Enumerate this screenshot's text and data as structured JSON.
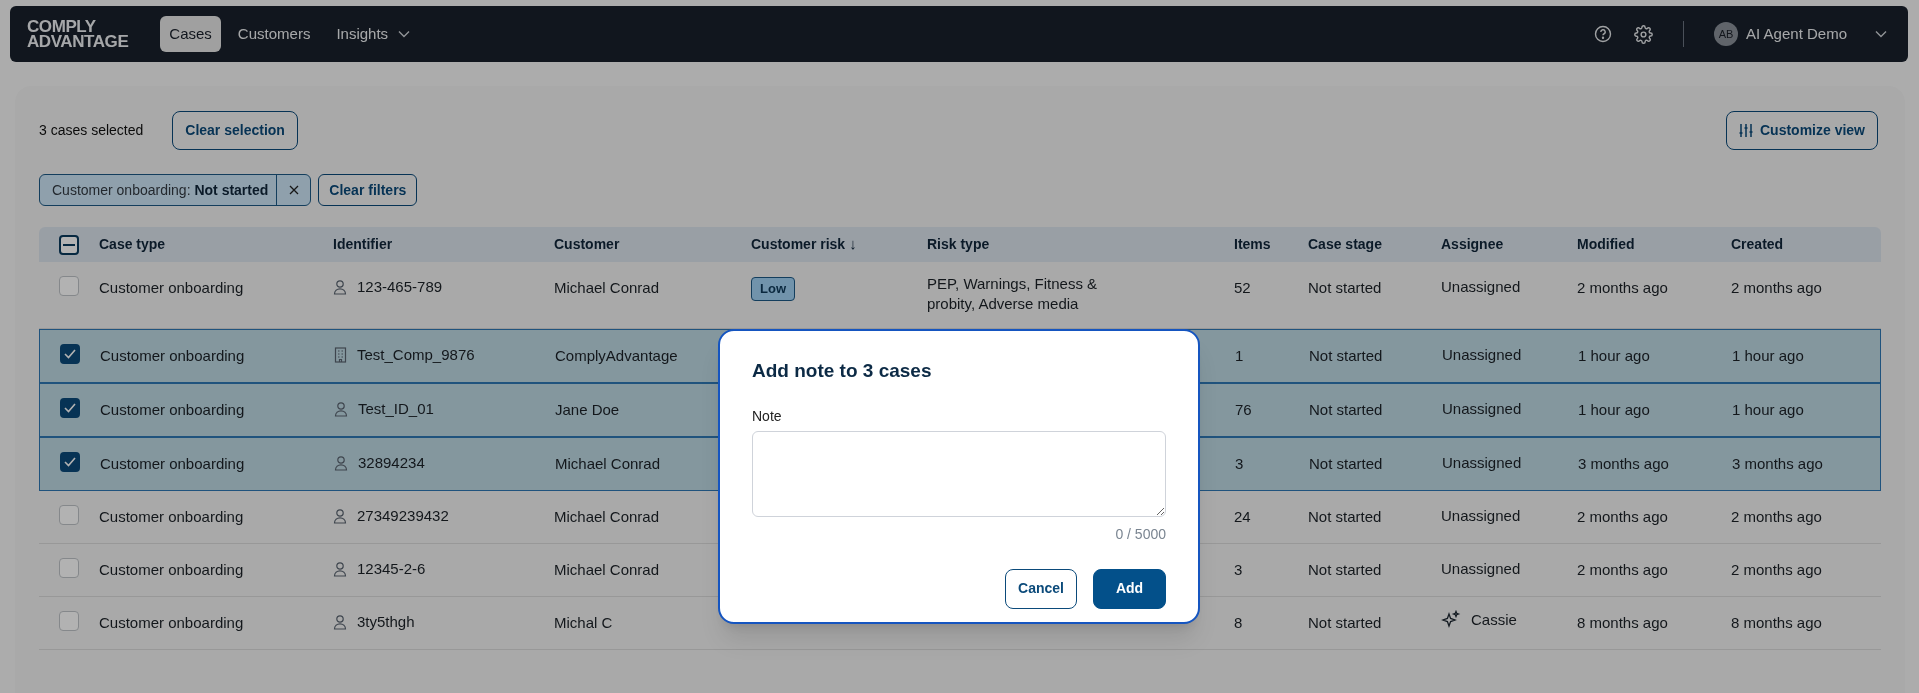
{
  "nav": {
    "logo": [
      "COMPLY",
      "ADVANTAGE"
    ],
    "items": [
      {
        "label": "Cases",
        "selected": true,
        "dropdown": false
      },
      {
        "label": "Customers",
        "selected": false,
        "dropdown": false
      },
      {
        "label": "Insights",
        "selected": false,
        "dropdown": true
      }
    ],
    "user": {
      "initials": "AB",
      "name": "AI Agent Demo"
    }
  },
  "selection": {
    "count_text": "3 cases selected",
    "clear_button": "Clear selection"
  },
  "customize_button": "Customize view",
  "filters": [
    {
      "label": "Customer onboarding:",
      "value": "Not started"
    }
  ],
  "clear_filters": "Clear filters",
  "table": {
    "select_all": {
      "indeterminate": true
    },
    "columns": [
      {
        "label": "Case type"
      },
      {
        "label": "Identifier"
      },
      {
        "label": "Customer"
      },
      {
        "label": "Customer risk",
        "sort_indicator": "↓"
      },
      {
        "label": "Risk type"
      },
      {
        "label": "Items"
      },
      {
        "label": "Case stage"
      },
      {
        "label": "Assignee"
      },
      {
        "label": "Modified"
      },
      {
        "label": "Created"
      }
    ],
    "rows": [
      {
        "selected": false,
        "case_type": "Customer onboarding",
        "identifier": {
          "kind": "person",
          "text": "123-465-789"
        },
        "customer": "Michael Conrad",
        "risk": "Low",
        "risk_type": "PEP, Warnings, Fitness & probity, Adverse media",
        "items": "52",
        "stage": "Not started",
        "assignee": {
          "kind": "none",
          "text": "Unassigned"
        },
        "modified": "2 months ago",
        "created": "2 months ago"
      },
      {
        "selected": true,
        "case_type": "Customer onboarding",
        "identifier": {
          "kind": "company",
          "text": "Test_Comp_9876"
        },
        "customer": "ComplyAdvantage",
        "items": "1",
        "stage": "Not started",
        "assignee": {
          "kind": "none",
          "text": "Unassigned"
        },
        "modified": "1 hour ago",
        "created": "1 hour ago"
      },
      {
        "selected": true,
        "case_type": "Customer onboarding",
        "identifier": {
          "kind": "person",
          "text": "Test_ID_01"
        },
        "customer": "Jane Doe",
        "items": "76",
        "stage": "Not started",
        "assignee": {
          "kind": "none",
          "text": "Unassigned"
        },
        "modified": "1 hour ago",
        "created": "1 hour ago"
      },
      {
        "selected": true,
        "case_type": "Customer onboarding",
        "identifier": {
          "kind": "person",
          "text": "32894234"
        },
        "customer": "Michael Conrad",
        "items": "3",
        "stage": "Not started",
        "assignee": {
          "kind": "none",
          "text": "Unassigned"
        },
        "modified": "3 months ago",
        "created": "3 months ago"
      },
      {
        "selected": false,
        "case_type": "Customer onboarding",
        "identifier": {
          "kind": "person",
          "text": "27349239432"
        },
        "customer": "Michael Conrad",
        "items": "24",
        "stage": "Not started",
        "assignee": {
          "kind": "none",
          "text": "Unassigned"
        },
        "modified": "2 months ago",
        "created": "2 months ago"
      },
      {
        "selected": false,
        "case_type": "Customer onboarding",
        "identifier": {
          "kind": "person",
          "text": "12345-2-6"
        },
        "customer": "Michael Conrad",
        "items": "3",
        "stage": "Not started",
        "assignee": {
          "kind": "none",
          "text": "Unassigned"
        },
        "modified": "2 months ago",
        "created": "2 months ago"
      },
      {
        "selected": false,
        "case_type": "Customer onboarding",
        "identifier": {
          "kind": "person",
          "text": "3ty5thgh"
        },
        "customer": "Michal C",
        "items": "8",
        "stage": "Not started",
        "assignee": {
          "kind": "ai",
          "text": "Cassie"
        },
        "modified": "8 months ago",
        "created": "8 months ago"
      }
    ]
  },
  "modal": {
    "title": "Add note to 3 cases",
    "field_label": "Note",
    "counter": "0 / 5000",
    "buttons": [
      {
        "label": "Cancel",
        "kind": "secondary"
      },
      {
        "label": "Add",
        "kind": "primary"
      }
    ]
  }
}
